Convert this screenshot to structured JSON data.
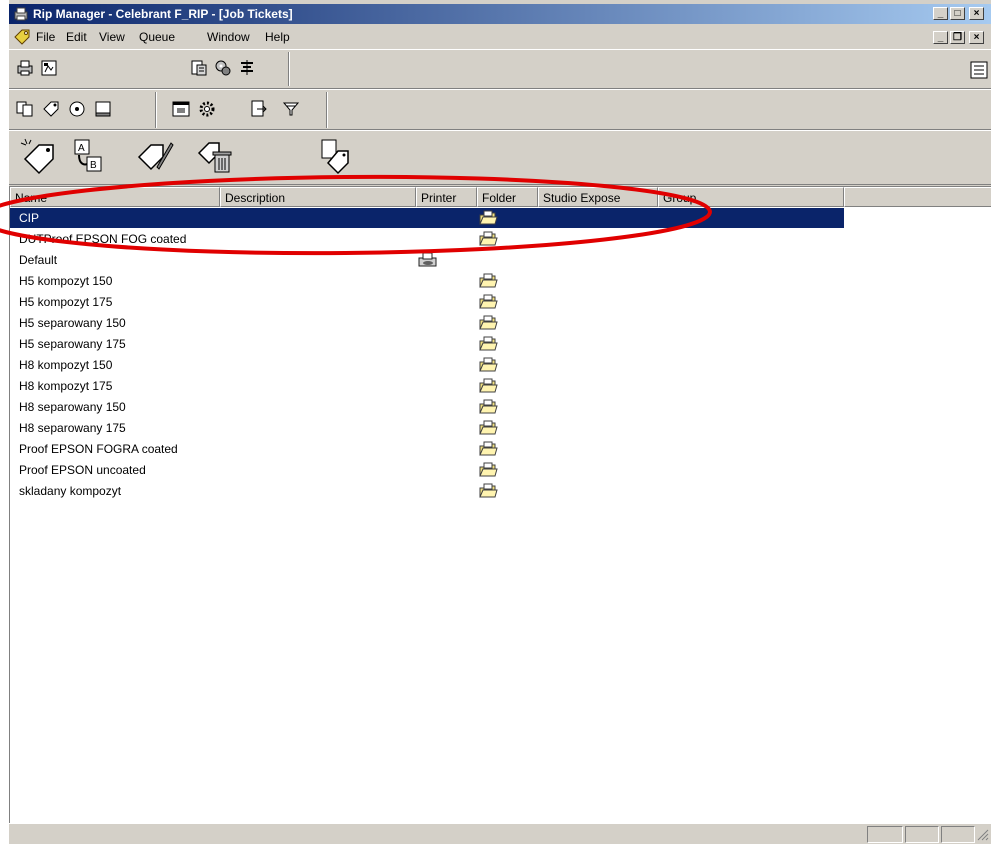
{
  "window": {
    "title": "Rip Manager - Celebrant F_RIP - [Job Tickets]",
    "minimize_glyph": "_",
    "maximize_glyph": "□",
    "close_glyph": "×",
    "restore_glyph": "❐"
  },
  "menu": {
    "items": [
      "File",
      "Edit",
      "View",
      "Queue",
      "Window",
      "Help"
    ]
  },
  "list": {
    "columns": [
      "Name",
      "Description",
      "Printer",
      "Folder",
      "Studio Expose",
      "Group"
    ],
    "rows": [
      {
        "name": "CIP",
        "printer": false,
        "folder": true,
        "selected": true
      },
      {
        "name": "DUTProof EPSON FOG coated",
        "printer": false,
        "folder": true,
        "selected": false
      },
      {
        "name": "Default",
        "printer": true,
        "folder": false,
        "selected": false
      },
      {
        "name": "H5 kompozyt 150",
        "printer": false,
        "folder": true,
        "selected": false
      },
      {
        "name": "H5 kompozyt 175",
        "printer": false,
        "folder": true,
        "selected": false
      },
      {
        "name": "H5 separowany 150",
        "printer": false,
        "folder": true,
        "selected": false
      },
      {
        "name": "H5 separowany 175",
        "printer": false,
        "folder": true,
        "selected": false
      },
      {
        "name": "H8 kompozyt 150",
        "printer": false,
        "folder": true,
        "selected": false
      },
      {
        "name": "H8 kompozyt 175",
        "printer": false,
        "folder": true,
        "selected": false
      },
      {
        "name": "H8 separowany 150",
        "printer": false,
        "folder": true,
        "selected": false
      },
      {
        "name": "H8 separowany 175",
        "printer": false,
        "folder": true,
        "selected": false
      },
      {
        "name": "Proof EPSON FOGRA coated",
        "printer": false,
        "folder": true,
        "selected": false
      },
      {
        "name": "Proof EPSON uncoated",
        "printer": false,
        "folder": true,
        "selected": false
      },
      {
        "name": "skladany kompozyt",
        "printer": false,
        "folder": true,
        "selected": false
      }
    ]
  },
  "colors": {
    "selection": "#0a246a",
    "annotation_ellipse": "#e00000",
    "folder_icon": "#f0e080"
  },
  "icons": {
    "toolbar1": [
      "printer-icon",
      "document-icon",
      "properties-icon",
      "settings-icon",
      "list-icon",
      "options-icon"
    ],
    "toolbar2": [
      "copy-icon",
      "tag-icon",
      "disc-icon",
      "monitor-icon",
      "screen-icon",
      "gear-icon",
      "export-icon",
      "filter-icon"
    ],
    "toolbar3": [
      "new-ticket-icon",
      "rename-ticket-icon",
      "edit-ticket-icon",
      "delete-ticket-icon",
      "copy-ticket-icon"
    ]
  }
}
